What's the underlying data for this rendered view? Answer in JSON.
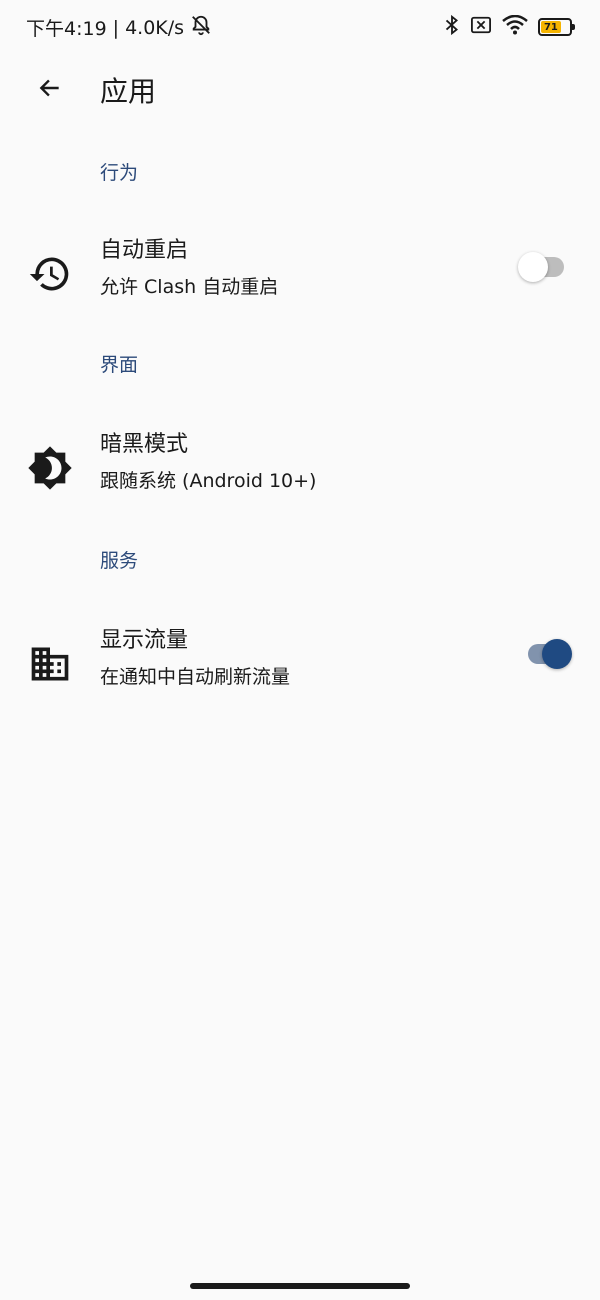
{
  "status_bar": {
    "time": "下午4:19",
    "net_speed": "4.0K/s",
    "battery_level": "71",
    "battery_color": "#f5b400",
    "icons": [
      "bell-off-icon",
      "bluetooth-icon",
      "sim-off-icon",
      "wifi-icon",
      "battery-icon"
    ]
  },
  "app_bar": {
    "title": "应用",
    "back_icon": "arrow-back-icon"
  },
  "sections": [
    {
      "header": "行为",
      "item": {
        "icon": "history-icon",
        "title": "自动重启",
        "summary": "允许 Clash 自动重启",
        "switch": "off"
      }
    },
    {
      "header": "界面",
      "item": {
        "icon": "brightness-icon",
        "title": "暗黑模式",
        "summary": "跟随系统 (Android 10+)"
      }
    },
    {
      "header": "服务",
      "item": {
        "icon": "business-icon",
        "title": "显示流量",
        "summary": "在通知中自动刷新流量",
        "switch": "on"
      }
    }
  ],
  "colors": {
    "accent": "#2c4a7a",
    "switch_on_thumb": "#1f4a82",
    "switch_on_track": "#8193ad",
    "background": "#fafafa"
  }
}
